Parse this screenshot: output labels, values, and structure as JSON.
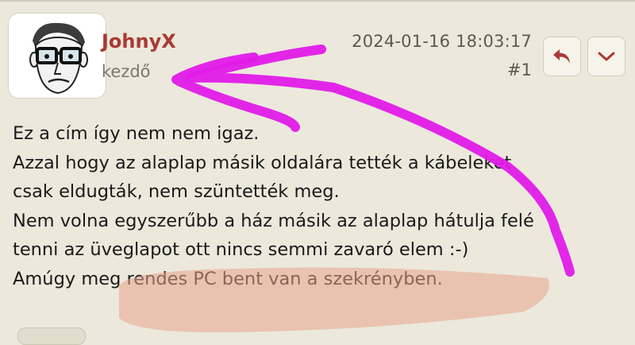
{
  "post": {
    "author": "JohnyX",
    "rank": "kezdő",
    "timestamp": "2024-01-16 18:03:17",
    "post_number": "#1",
    "body_lines": [
      "Ez a cím így nem nem igaz.",
      "Azzal hogy az alaplap másik oldalára tették a kábeleket",
      "csak eldugták, nem szüntették meg.",
      "Nem volna egyszerűbb a ház másik az alaplap hátulja felé",
      "tenni az üveglapot ott nincs semmi zavaró elem :-)",
      "Amúgy meg rendes PC bent van a szekrényben."
    ]
  },
  "actions": {
    "reply_icon": "reply-arrow-icon",
    "more_icon": "chevron-down-icon"
  },
  "colors": {
    "accent": "#a83a32",
    "background": "#ece8dc",
    "annotation_arrow": "#e11be8",
    "annotation_highlight": "#e8a48a"
  }
}
